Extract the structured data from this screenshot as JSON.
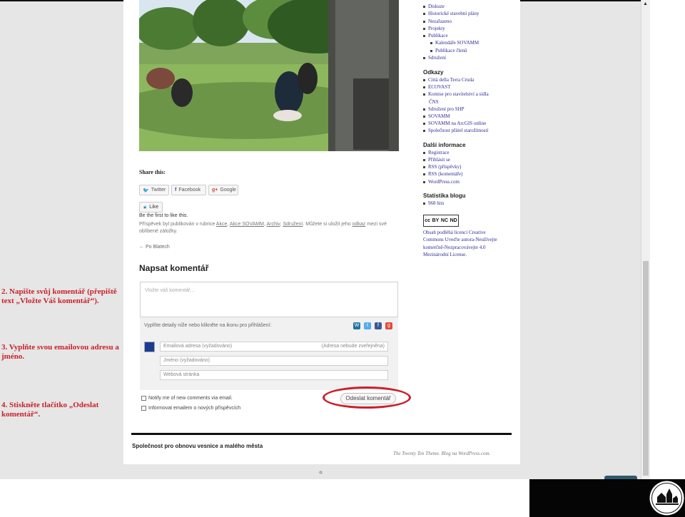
{
  "sidebar": {
    "top_items": [
      {
        "label": "Diskuze"
      },
      {
        "label": "Historické stavební plány"
      },
      {
        "label": "Nezařazeno"
      },
      {
        "label": "Projekty"
      },
      {
        "label": "Publikace"
      },
      {
        "label": "Kalendáře SOVAMM"
      },
      {
        "label": "Publikace členů"
      },
      {
        "label": "Sdružení"
      }
    ],
    "links_title": "Odkazy",
    "links": [
      {
        "label": "Città della Terra Cruda"
      },
      {
        "label": "ECOVAST"
      },
      {
        "label": "Komise pro stavitelství a sídla"
      },
      {
        "label": "ČNS"
      },
      {
        "label": "Sdružení pro SHP"
      },
      {
        "label": "SOVAMM"
      },
      {
        "label": "SOVAMM na ArcGIS online"
      },
      {
        "label": "Společnost přátel starožitností"
      }
    ],
    "info_title": "Další informace",
    "info": [
      {
        "label": "Registrace"
      },
      {
        "label": "Přihlásit se"
      },
      {
        "label": "RSS (příspěvky)"
      },
      {
        "label": "RSS (komentáře)"
      },
      {
        "label": "WordPress.com"
      }
    ],
    "stats_title": "Statistika blogu",
    "stats": {
      "hits": "968 hits"
    },
    "license_text": "Obsah podléhá licenci Creative Commons Uveďte autora-Neužívejte komerčně-Nezpracovávejte 4.0 Mezinárodní License.",
    "cc_badge": {
      "cc": "cc",
      "by": "BY",
      "nc": "NC",
      "nd": "ND"
    }
  },
  "post": {
    "share_title": "Share this:",
    "share_buttons": [
      {
        "label": "Twitter"
      },
      {
        "label": "Facebook"
      },
      {
        "label": "Google"
      }
    ],
    "like_label": "Like",
    "like_note": "Be the first to like this.",
    "meta_text": {
      "prefix": "Příspěvek byl publikován v rubrice ",
      "cat1": "Akce",
      "sep1": ", ",
      "cat2": "Akce SOVAMM",
      "sep2": ", ",
      "cat3": "Archiv",
      "sep3": ", ",
      "cat4": "Sdružení",
      "middle": ". Můžete si uložit jeho ",
      "link": "odkaz",
      "suffix": " mezi své oblíbené záložky."
    },
    "prev_link": "← Po Blatech"
  },
  "comment": {
    "title": "Napsat komentář",
    "placeholder": "Vložte váš komentář…",
    "details_text": "Vyplňte detaily níže nebo klikněte na ikonu pro přihlášení:",
    "email_placeholder": "Emailová adresa (vyžadováno)",
    "email_note": "(Adresa nebude zveřejněna)",
    "name_placeholder": "Jméno (vyžadováno)",
    "website_placeholder": "Webová stránka",
    "notify_comments": "Notify me of new comments via email.",
    "notify_posts": "Informovat emailem o nových příspěvcích",
    "submit_label": "Odeslat komentář"
  },
  "footer": {
    "site_title": "Společnost pro obnovu vesnice a malého města",
    "credits": "The Twenty Ten Theme. Blog na WordPress.com."
  },
  "instructions": {
    "step2": "2. Napište svůj komentář (přepiště text „Vložte Váš komentář“).",
    "step3": "3. Vyplňte svou emailovou adresu a jméno.",
    "step4": "4. Stiskněte tlačítko „Odeslat komentář“."
  },
  "colors": {
    "highlight": "#c8202a",
    "link": "#2d2d96"
  }
}
